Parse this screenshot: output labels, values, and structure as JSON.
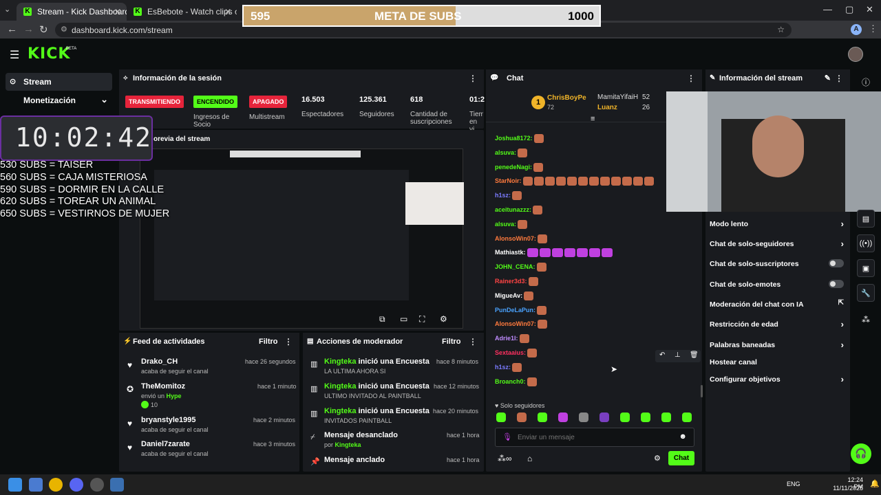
{
  "browser": {
    "tabs": [
      {
        "title": "Stream - Kick Dashboard"
      },
      {
        "title": "EsBebote - Watch clips on Kick"
      }
    ],
    "url": "dashboard.kick.com/stream"
  },
  "goal_bar": {
    "current": "595",
    "title": "META DE SUBS",
    "target": "1000",
    "progress": 0.595
  },
  "kick": {
    "logo": "KICK",
    "beta": "BETA"
  },
  "sidebar": {
    "items": [
      {
        "label": "Stream"
      },
      {
        "label": "Monetización"
      }
    ]
  },
  "overlay": {
    "clock": "10:02:42",
    "subs": [
      "530 SUBS = TAISER",
      "560 SUBS =  CAJA MISTERIOSA",
      "590 SUBS = DORMIR EN LA CALLE",
      "620 SUBS = TOREAR UN ANIMAL",
      "650 SUBS = VESTIRNOS DE MUJER"
    ]
  },
  "session": {
    "title": "Información de la sesión",
    "badges": {
      "live": "TRANSMITIENDO",
      "income": "ENCENDIDO",
      "multistream": "APAGADO"
    },
    "labels": {
      "income": "Ingresos de Socio",
      "multistream": "Multistream"
    },
    "stats": [
      {
        "value": "16.503",
        "label": "Espectadores"
      },
      {
        "value": "125.361",
        "label": "Seguidores"
      },
      {
        "value": "618",
        "label": "Cantidad de suscripciones"
      },
      {
        "value": "01:2",
        "label": "Tiem en vi"
      }
    ]
  },
  "preview": {
    "title": "orevia del stream"
  },
  "activity": {
    "title": "Feed de actividades",
    "filter": "Filtro",
    "items": [
      {
        "name": "Drako_CH",
        "time": "hace 26 segundos",
        "text": "acaba de seguir el canal"
      },
      {
        "name": "TheMomitoz",
        "time": "hace 1 minuto",
        "text": "envió un",
        "highlight": "Hype",
        "amount": "10"
      },
      {
        "name": "bryanstyle1995",
        "time": "hace 2 minutos",
        "text": "acaba de seguir el canal"
      },
      {
        "name": "Daniel7zarate",
        "time": "hace 3 minutos",
        "text": "acaba de seguir el canal"
      }
    ]
  },
  "modactions": {
    "title": "Acciones de moderador",
    "filter": "Filtro",
    "items": [
      {
        "name": "Kingteka",
        "action": "inició una Encuesta",
        "time": "hace 8 minutos",
        "detail": "LA ULTIMA AHORA SI"
      },
      {
        "name": "Kingteka",
        "action": "inició una Encuesta",
        "time": "hace 12 minutos",
        "detail": "ULTIMO INVITADO AL PAINTBALL"
      },
      {
        "name": "Kingteka",
        "action": "inició una Encuesta",
        "time": "hace 20 minutos",
        "detail": "INVITADOS PAINTBALL"
      },
      {
        "name": "Mensaje desanclado",
        "action": "",
        "time": "hace 1 hora",
        "detail": "por",
        "by": "Kingteka"
      },
      {
        "name": "Mensaje anclado",
        "action": "",
        "time": "hace 1 hora",
        "detail": ""
      }
    ]
  },
  "chat": {
    "title": "Chat",
    "top": [
      {
        "name": "ChrisBoyPe",
        "count": "72",
        "rank": "1"
      },
      {
        "name": "MamitaYifaiH",
        "count": "52"
      },
      {
        "name": "Luanz",
        "count": "26"
      }
    ],
    "messages": [
      {
        "user": "Joshua8172:",
        "color": "#53fc18",
        "emotes": 1
      },
      {
        "user": "alsuva:",
        "color": "#53fc18",
        "emotes": 1
      },
      {
        "user": "penedeNagi:",
        "color": "#53fc18",
        "emotes": 1
      },
      {
        "user": "StarNoir:",
        "color": "#ff7a3d",
        "emotes": 12
      },
      {
        "user": "h1sz:",
        "color": "#7b7bff",
        "emotes": 1
      },
      {
        "user": "aceitunazzz:",
        "color": "#53fc18",
        "emotes": 1
      },
      {
        "user": "alsuva:",
        "color": "#53fc18",
        "emotes": 1
      },
      {
        "user": "AlonsoWin07:",
        "color": "#ff7a3d",
        "emotes": 1
      },
      {
        "user": "Mathiastk:",
        "color": "#ffffff",
        "emotes": 7,
        "purple": true
      },
      {
        "user": "JOHN_CENA:",
        "color": "#53fc18",
        "emotes": 1
      },
      {
        "user": "Rainer3d3:",
        "color": "#ff4444",
        "emotes": 1
      },
      {
        "user": "MigueAv:",
        "color": "#ffffff",
        "emotes": 1
      },
      {
        "user": "PunDeLaPun:",
        "color": "#4aa3ff",
        "emotes": 1
      },
      {
        "user": "AlonsoWin07:",
        "color": "#ff7a3d",
        "emotes": 1
      },
      {
        "user": "Adrie1I:",
        "color": "#c08cff",
        "emotes": 1
      },
      {
        "user": "Sextaaius:",
        "color": "#ff3060",
        "emotes": 1
      },
      {
        "user": "h1sz:",
        "color": "#7b7bff",
        "emotes": 1
      },
      {
        "user": "Broanch0:",
        "color": "#53fc18",
        "emotes": 1
      }
    ],
    "mode": "Solo seguidores",
    "input_placeholder": "Enviar un mensaje",
    "send": "Chat"
  },
  "stream_info": {
    "title": "Información del stream",
    "settings": [
      {
        "label": "Modo lento",
        "control": "chevron"
      },
      {
        "label": "Chat de solo-seguidores",
        "control": "chevron"
      },
      {
        "label": "Chat de solo-suscriptores",
        "control": "toggle"
      },
      {
        "label": "Chat de solo-emotes",
        "control": "toggle"
      },
      {
        "label": "Moderación del chat con IA",
        "control": "external"
      },
      {
        "label": "Restricción de edad",
        "control": "chevron"
      },
      {
        "label": "Palabras baneadas",
        "control": "chevron"
      },
      {
        "label": "Hostear canal",
        "control": "none"
      },
      {
        "label": "Configurar objetivos",
        "control": "chevron"
      }
    ]
  },
  "taskbar": {
    "lang": "ENG",
    "time": "12:24 PM",
    "date": "11/11/2025"
  }
}
